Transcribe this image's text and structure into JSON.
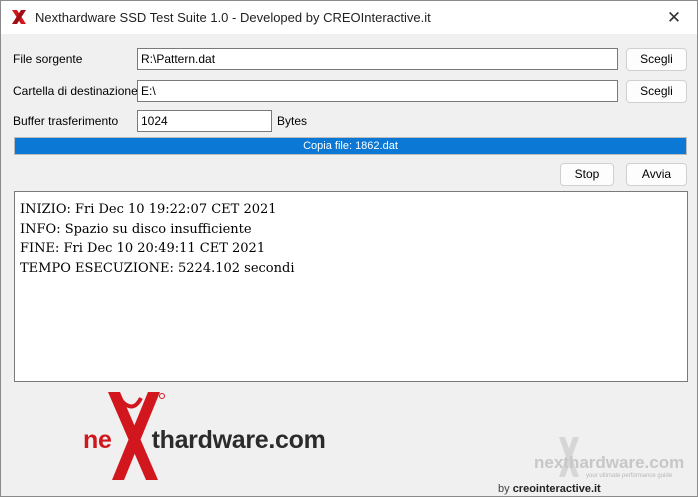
{
  "window": {
    "title": "Nexthardware SSD Test Suite 1.0 - Developed by CREOInteractive.it",
    "close_glyph": "✕"
  },
  "form": {
    "source_label": "File sorgente",
    "source_value": "R:\\Pattern.dat",
    "dest_label": "Cartella di destinazione",
    "dest_value": "E:\\",
    "buffer_label": "Buffer trasferimento",
    "buffer_value": "1024",
    "buffer_unit": "Bytes",
    "browse_source": "Scegli",
    "browse_dest": "Scegli"
  },
  "progress": {
    "text": "Copia file: 1862.dat",
    "fraction": 1.0,
    "color": "#0b78d6"
  },
  "actions": {
    "stop": "Stop",
    "start": "Avvia"
  },
  "log": {
    "lines": [
      "INIZIO: Fri Dec 10 19:22:07 CET 2021",
      "INFO: Spazio su disco insufficiente",
      "FINE: Fri Dec 10 20:49:11 CET 2021",
      "TEMPO ESECUZIONE: 5224.102 secondi"
    ]
  },
  "branding": {
    "logo_prefix": "ne",
    "logo_rest": "thardware.com",
    "watermark_text": "nexthardware.com",
    "watermark_tagline": "your ultimate performance guide",
    "by_prefix": "by ",
    "by_brand": "creointeractive.it",
    "accent_red": "#d2161e",
    "text_dark": "#2b2b2b"
  }
}
